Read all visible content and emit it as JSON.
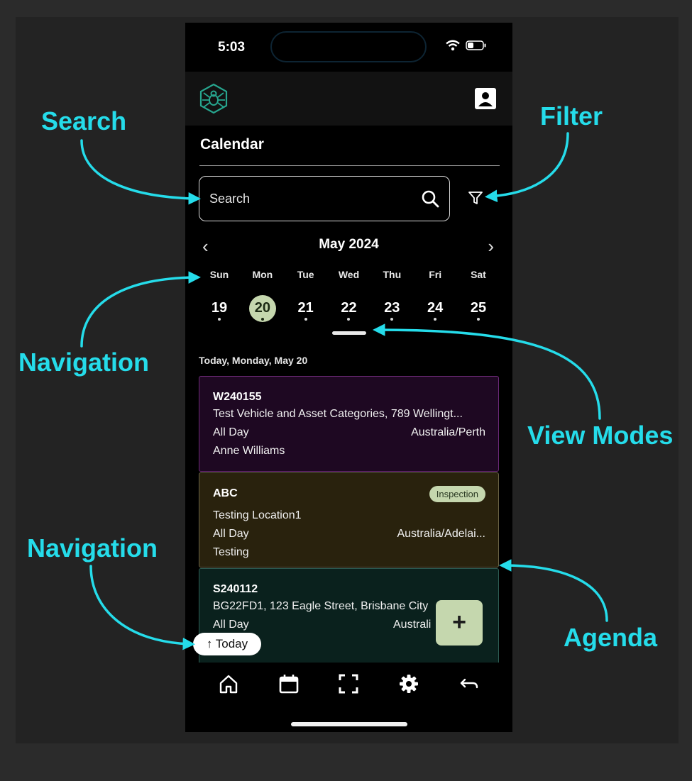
{
  "status_bar": {
    "time": "5:03"
  },
  "header": {
    "logo": "spider-logo",
    "profile_icon": "account-box-icon"
  },
  "page_title": "Calendar",
  "search": {
    "placeholder": "Search",
    "icon": "search-icon",
    "filter_icon": "filter-icon"
  },
  "calendar": {
    "month_label": "May 2024",
    "weekdays": [
      "Sun",
      "Mon",
      "Tue",
      "Wed",
      "Thu",
      "Fri",
      "Sat"
    ],
    "days": [
      "19",
      "20",
      "21",
      "22",
      "23",
      "24",
      "25"
    ],
    "selected_day": "20"
  },
  "agenda": {
    "heading": "Today, Monday, May 20",
    "events": [
      {
        "code": "W240155",
        "location": "Test Vehicle and Asset Categories, 789 Wellingt...",
        "time": "All Day",
        "timezone": "Australia/Perth",
        "assignee": "Anne Williams"
      },
      {
        "code": "ABC",
        "badge": "Inspection",
        "location": "Testing Location1",
        "time": "All Day",
        "timezone": "Australia/Adelai...",
        "assignee": "Testing"
      },
      {
        "code": "S240112",
        "location": "BG22FD1, 123 Eagle Street, Brisbane City",
        "time": "All Day",
        "timezone": "Australi"
      }
    ]
  },
  "fab_label": "+",
  "today_button": "↑ Today",
  "bottom_nav": [
    "home-icon",
    "calendar-icon",
    "scan-icon",
    "settings-icon",
    "back-icon"
  ],
  "annotations": {
    "search": "Search",
    "filter": "Filter",
    "navigation_top": "Navigation",
    "view_modes": "View Modes",
    "navigation_bottom": "Navigation",
    "agenda": "Agenda"
  },
  "colors": {
    "annotation": "#25dcea",
    "accent": "#c5d7ae",
    "card_purple": "#1e0822",
    "card_olive": "#29220d",
    "card_teal": "#0a211d"
  }
}
